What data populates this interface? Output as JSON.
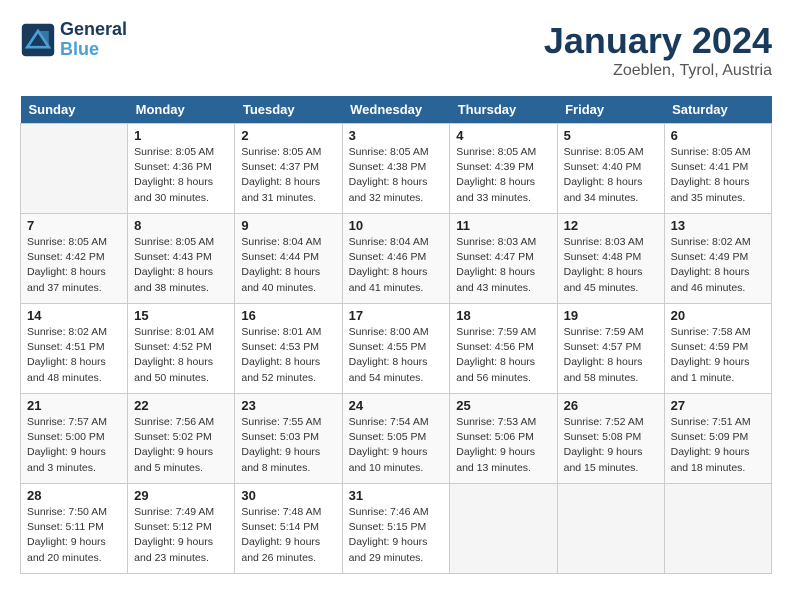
{
  "header": {
    "logo_line1": "General",
    "logo_line2": "Blue",
    "month_year": "January 2024",
    "location": "Zoeblen, Tyrol, Austria"
  },
  "weekdays": [
    "Sunday",
    "Monday",
    "Tuesday",
    "Wednesday",
    "Thursday",
    "Friday",
    "Saturday"
  ],
  "weeks": [
    [
      {
        "day": "",
        "info": ""
      },
      {
        "day": "1",
        "info": "Sunrise: 8:05 AM\nSunset: 4:36 PM\nDaylight: 8 hours\nand 30 minutes."
      },
      {
        "day": "2",
        "info": "Sunrise: 8:05 AM\nSunset: 4:37 PM\nDaylight: 8 hours\nand 31 minutes."
      },
      {
        "day": "3",
        "info": "Sunrise: 8:05 AM\nSunset: 4:38 PM\nDaylight: 8 hours\nand 32 minutes."
      },
      {
        "day": "4",
        "info": "Sunrise: 8:05 AM\nSunset: 4:39 PM\nDaylight: 8 hours\nand 33 minutes."
      },
      {
        "day": "5",
        "info": "Sunrise: 8:05 AM\nSunset: 4:40 PM\nDaylight: 8 hours\nand 34 minutes."
      },
      {
        "day": "6",
        "info": "Sunrise: 8:05 AM\nSunset: 4:41 PM\nDaylight: 8 hours\nand 35 minutes."
      }
    ],
    [
      {
        "day": "7",
        "info": "Sunrise: 8:05 AM\nSunset: 4:42 PM\nDaylight: 8 hours\nand 37 minutes."
      },
      {
        "day": "8",
        "info": "Sunrise: 8:05 AM\nSunset: 4:43 PM\nDaylight: 8 hours\nand 38 minutes."
      },
      {
        "day": "9",
        "info": "Sunrise: 8:04 AM\nSunset: 4:44 PM\nDaylight: 8 hours\nand 40 minutes."
      },
      {
        "day": "10",
        "info": "Sunrise: 8:04 AM\nSunset: 4:46 PM\nDaylight: 8 hours\nand 41 minutes."
      },
      {
        "day": "11",
        "info": "Sunrise: 8:03 AM\nSunset: 4:47 PM\nDaylight: 8 hours\nand 43 minutes."
      },
      {
        "day": "12",
        "info": "Sunrise: 8:03 AM\nSunset: 4:48 PM\nDaylight: 8 hours\nand 45 minutes."
      },
      {
        "day": "13",
        "info": "Sunrise: 8:02 AM\nSunset: 4:49 PM\nDaylight: 8 hours\nand 46 minutes."
      }
    ],
    [
      {
        "day": "14",
        "info": "Sunrise: 8:02 AM\nSunset: 4:51 PM\nDaylight: 8 hours\nand 48 minutes."
      },
      {
        "day": "15",
        "info": "Sunrise: 8:01 AM\nSunset: 4:52 PM\nDaylight: 8 hours\nand 50 minutes."
      },
      {
        "day": "16",
        "info": "Sunrise: 8:01 AM\nSunset: 4:53 PM\nDaylight: 8 hours\nand 52 minutes."
      },
      {
        "day": "17",
        "info": "Sunrise: 8:00 AM\nSunset: 4:55 PM\nDaylight: 8 hours\nand 54 minutes."
      },
      {
        "day": "18",
        "info": "Sunrise: 7:59 AM\nSunset: 4:56 PM\nDaylight: 8 hours\nand 56 minutes."
      },
      {
        "day": "19",
        "info": "Sunrise: 7:59 AM\nSunset: 4:57 PM\nDaylight: 8 hours\nand 58 minutes."
      },
      {
        "day": "20",
        "info": "Sunrise: 7:58 AM\nSunset: 4:59 PM\nDaylight: 9 hours\nand 1 minute."
      }
    ],
    [
      {
        "day": "21",
        "info": "Sunrise: 7:57 AM\nSunset: 5:00 PM\nDaylight: 9 hours\nand 3 minutes."
      },
      {
        "day": "22",
        "info": "Sunrise: 7:56 AM\nSunset: 5:02 PM\nDaylight: 9 hours\nand 5 minutes."
      },
      {
        "day": "23",
        "info": "Sunrise: 7:55 AM\nSunset: 5:03 PM\nDaylight: 9 hours\nand 8 minutes."
      },
      {
        "day": "24",
        "info": "Sunrise: 7:54 AM\nSunset: 5:05 PM\nDaylight: 9 hours\nand 10 minutes."
      },
      {
        "day": "25",
        "info": "Sunrise: 7:53 AM\nSunset: 5:06 PM\nDaylight: 9 hours\nand 13 minutes."
      },
      {
        "day": "26",
        "info": "Sunrise: 7:52 AM\nSunset: 5:08 PM\nDaylight: 9 hours\nand 15 minutes."
      },
      {
        "day": "27",
        "info": "Sunrise: 7:51 AM\nSunset: 5:09 PM\nDaylight: 9 hours\nand 18 minutes."
      }
    ],
    [
      {
        "day": "28",
        "info": "Sunrise: 7:50 AM\nSunset: 5:11 PM\nDaylight: 9 hours\nand 20 minutes."
      },
      {
        "day": "29",
        "info": "Sunrise: 7:49 AM\nSunset: 5:12 PM\nDaylight: 9 hours\nand 23 minutes."
      },
      {
        "day": "30",
        "info": "Sunrise: 7:48 AM\nSunset: 5:14 PM\nDaylight: 9 hours\nand 26 minutes."
      },
      {
        "day": "31",
        "info": "Sunrise: 7:46 AM\nSunset: 5:15 PM\nDaylight: 9 hours\nand 29 minutes."
      },
      {
        "day": "",
        "info": ""
      },
      {
        "day": "",
        "info": ""
      },
      {
        "day": "",
        "info": ""
      }
    ]
  ]
}
